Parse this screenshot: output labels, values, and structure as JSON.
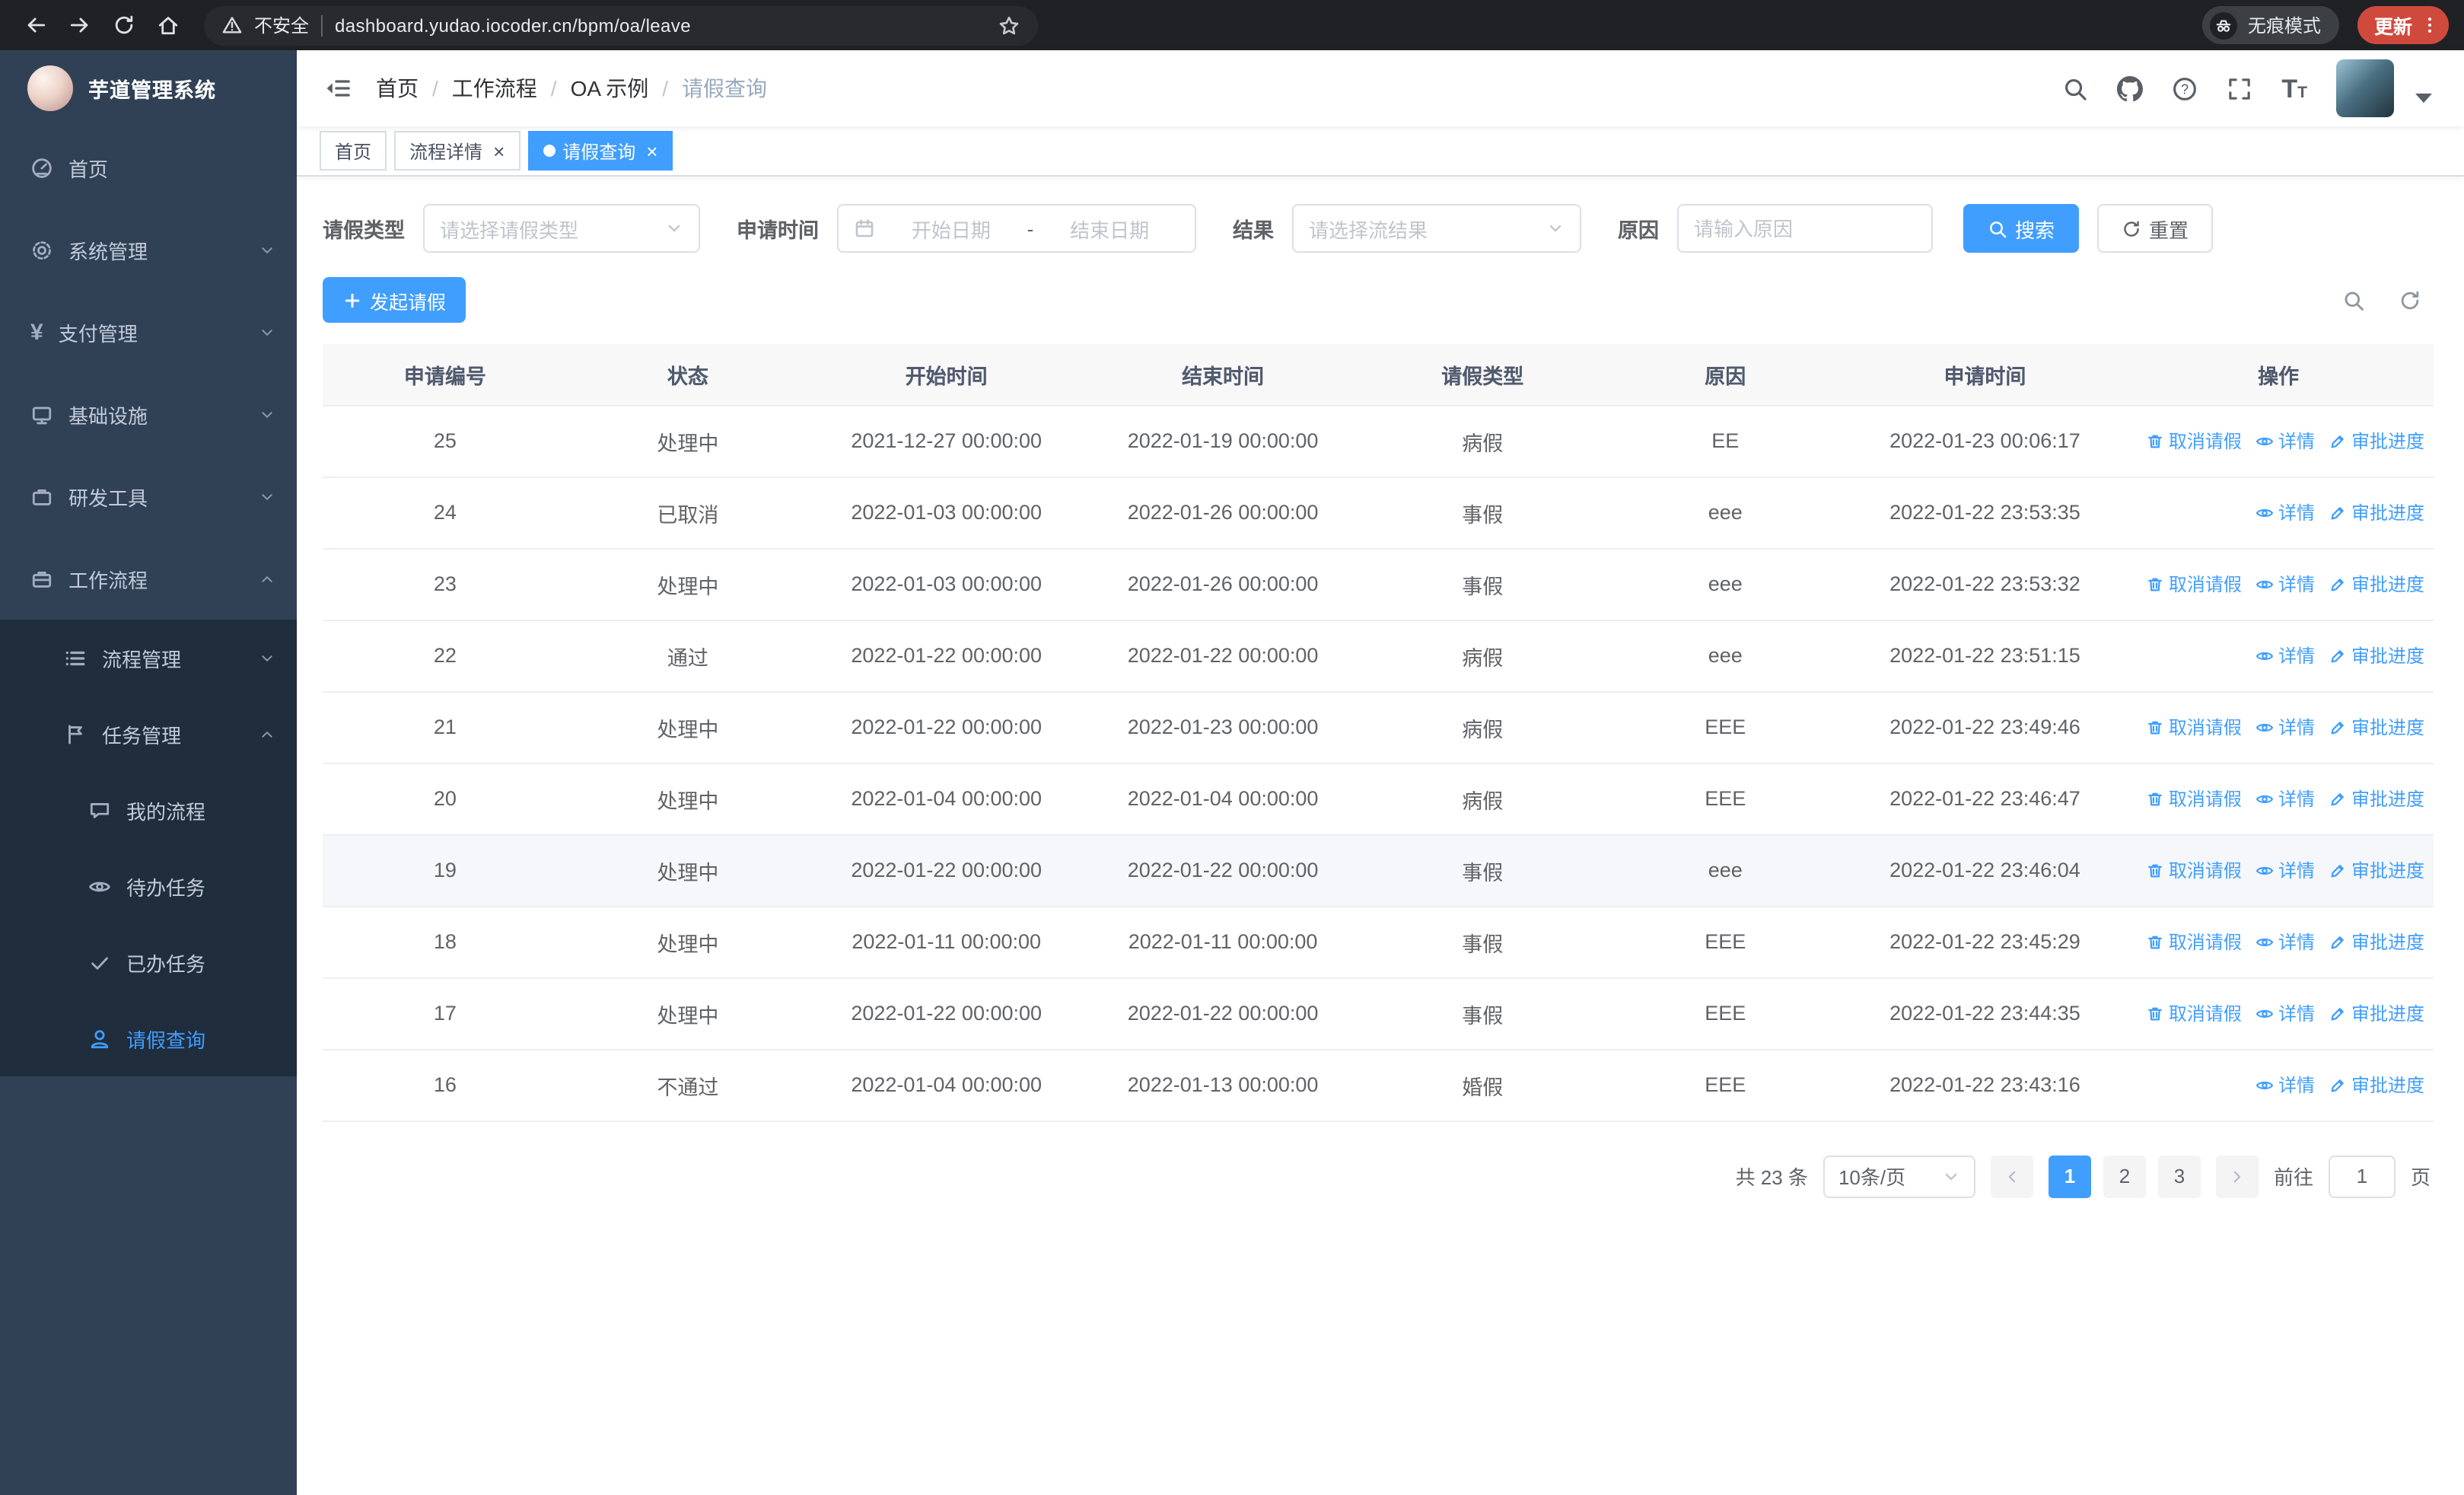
{
  "browser": {
    "security_label": "不安全",
    "url": "dashboard.yudao.iocoder.cn/bpm/oa/leave",
    "incognito_label": "无痕模式",
    "update_label": "更新"
  },
  "icons": {
    "note": "semantic icon names used across the UI",
    "list": [
      "back",
      "forward",
      "refresh",
      "home",
      "warning",
      "star",
      "incognito",
      "dots-v",
      "dashboard",
      "gear",
      "yen",
      "infra",
      "tools",
      "work",
      "list",
      "flag",
      "chat",
      "eye",
      "done",
      "person",
      "search",
      "github",
      "question",
      "fullscreen",
      "font-size",
      "caret-down",
      "chevron-down",
      "chevron-up",
      "chevron-left",
      "chevron-right",
      "calendar",
      "trash",
      "edit",
      "plus",
      "fold"
    ]
  },
  "sidebar": {
    "logo_title": "芋道管理系统",
    "menu": [
      {
        "id": "home",
        "label": "首页",
        "icon": "dashboard",
        "level": 0
      },
      {
        "id": "system-management",
        "label": "系统管理",
        "icon": "gear",
        "level": 0,
        "arrow": "down"
      },
      {
        "id": "payment-management",
        "label": "支付管理",
        "icon": "yen",
        "level": 0,
        "arrow": "down"
      },
      {
        "id": "infrastructure",
        "label": "基础设施",
        "icon": "infra",
        "level": 0,
        "arrow": "down"
      },
      {
        "id": "dev-tools",
        "label": "研发工具",
        "icon": "tools",
        "level": 0,
        "arrow": "down"
      },
      {
        "id": "workflow",
        "label": "工作流程",
        "icon": "work",
        "level": 0,
        "arrow": "up"
      },
      {
        "id": "process-management",
        "label": "流程管理",
        "icon": "list",
        "level": 1,
        "sub": true,
        "arrow": "down"
      },
      {
        "id": "task-management",
        "label": "任务管理",
        "icon": "flag",
        "level": 1,
        "sub": true,
        "arrow": "up"
      },
      {
        "id": "my-process",
        "label": "我的流程",
        "icon": "chat",
        "level": 2,
        "sub": true
      },
      {
        "id": "todo-tasks",
        "label": "待办任务",
        "icon": "eye",
        "level": 2,
        "sub": true
      },
      {
        "id": "done-tasks",
        "label": "已办任务",
        "icon": "done",
        "level": 2,
        "sub": true
      },
      {
        "id": "leave-query",
        "label": "请假查询",
        "icon": "person",
        "level": 2,
        "sub": true,
        "active": true
      }
    ]
  },
  "breadcrumb": {
    "items": [
      "首页",
      "工作流程",
      "OA 示例",
      "请假查询"
    ]
  },
  "tabs": {
    "items": [
      {
        "id": "home",
        "label": "首页"
      },
      {
        "id": "process-detail",
        "label": "流程详情",
        "closable": true
      },
      {
        "id": "leave-query",
        "label": "请假查询",
        "closable": true,
        "active": true
      }
    ]
  },
  "filters": {
    "leave_type": {
      "label": "请假类型",
      "placeholder": "请选择请假类型"
    },
    "apply_time": {
      "label": "申请时间",
      "start_placeholder": "开始日期",
      "separator": "-",
      "end_placeholder": "结束日期"
    },
    "result": {
      "label": "结果",
      "placeholder": "请选择流结果"
    },
    "reason": {
      "label": "原因",
      "placeholder": "请输入原因"
    },
    "search_label": "搜索",
    "reset_label": "重置"
  },
  "toolbar": {
    "create_label": "发起请假"
  },
  "table": {
    "columns": [
      "申请编号",
      "状态",
      "开始时间",
      "结束时间",
      "请假类型",
      "原因",
      "申请时间",
      "操作"
    ],
    "op_labels": {
      "cancel": "取消请假",
      "detail": "详情",
      "progress": "审批进度"
    },
    "op_icons": {
      "cancel": "trash",
      "detail": "eye",
      "progress": "edit"
    },
    "rows": [
      {
        "id": "25",
        "status": "处理中",
        "start": "2021-12-27 00:00:00",
        "end": "2022-01-19 00:00:00",
        "type": "病假",
        "reason": "EE",
        "applied": "2022-01-23 00:06:17",
        "ops": [
          "cancel",
          "detail",
          "progress"
        ]
      },
      {
        "id": "24",
        "status": "已取消",
        "start": "2022-01-03 00:00:00",
        "end": "2022-01-26 00:00:00",
        "type": "事假",
        "reason": "eee",
        "applied": "2022-01-22 23:53:35",
        "ops": [
          "detail",
          "progress"
        ]
      },
      {
        "id": "23",
        "status": "处理中",
        "start": "2022-01-03 00:00:00",
        "end": "2022-01-26 00:00:00",
        "type": "事假",
        "reason": "eee",
        "applied": "2022-01-22 23:53:32",
        "ops": [
          "cancel",
          "detail",
          "progress"
        ]
      },
      {
        "id": "22",
        "status": "通过",
        "start": "2022-01-22 00:00:00",
        "end": "2022-01-22 00:00:00",
        "type": "病假",
        "reason": "eee",
        "applied": "2022-01-22 23:51:15",
        "ops": [
          "detail",
          "progress"
        ]
      },
      {
        "id": "21",
        "status": "处理中",
        "start": "2022-01-22 00:00:00",
        "end": "2022-01-23 00:00:00",
        "type": "病假",
        "reason": "EEE",
        "applied": "2022-01-22 23:49:46",
        "ops": [
          "cancel",
          "detail",
          "progress"
        ]
      },
      {
        "id": "20",
        "status": "处理中",
        "start": "2022-01-04 00:00:00",
        "end": "2022-01-04 00:00:00",
        "type": "病假",
        "reason": "EEE",
        "applied": "2022-01-22 23:46:47",
        "ops": [
          "cancel",
          "detail",
          "progress"
        ]
      },
      {
        "id": "19",
        "status": "处理中",
        "start": "2022-01-22 00:00:00",
        "end": "2022-01-22 00:00:00",
        "type": "事假",
        "reason": "eee",
        "applied": "2022-01-22 23:46:04",
        "ops": [
          "cancel",
          "detail",
          "progress"
        ],
        "highlight": true
      },
      {
        "id": "18",
        "status": "处理中",
        "start": "2022-01-11 00:00:00",
        "end": "2022-01-11 00:00:00",
        "type": "事假",
        "reason": "EEE",
        "applied": "2022-01-22 23:45:29",
        "ops": [
          "cancel",
          "detail",
          "progress"
        ]
      },
      {
        "id": "17",
        "status": "处理中",
        "start": "2022-01-22 00:00:00",
        "end": "2022-01-22 00:00:00",
        "type": "事假",
        "reason": "EEE",
        "applied": "2022-01-22 23:44:35",
        "ops": [
          "cancel",
          "detail",
          "progress"
        ]
      },
      {
        "id": "16",
        "status": "不通过",
        "start": "2022-01-04 00:00:00",
        "end": "2022-01-13 00:00:00",
        "type": "婚假",
        "reason": "EEE",
        "applied": "2022-01-22 23:43:16",
        "ops": [
          "detail",
          "progress"
        ]
      }
    ]
  },
  "pagination": {
    "total_label": "共 23 条",
    "page_size": "10条/页",
    "pages": [
      "1",
      "2",
      "3"
    ],
    "active_page": "1",
    "goto_label": "前往",
    "goto_value": "1",
    "page_suffix": "页"
  },
  "colors": {
    "primary": "#409eff",
    "sidebar_bg": "#304156",
    "submenu_bg": "#1f2d3d",
    "chrome_bg": "#202124",
    "update_chip": "#cf4a3d",
    "table_header_bg": "#f8f8f9"
  }
}
